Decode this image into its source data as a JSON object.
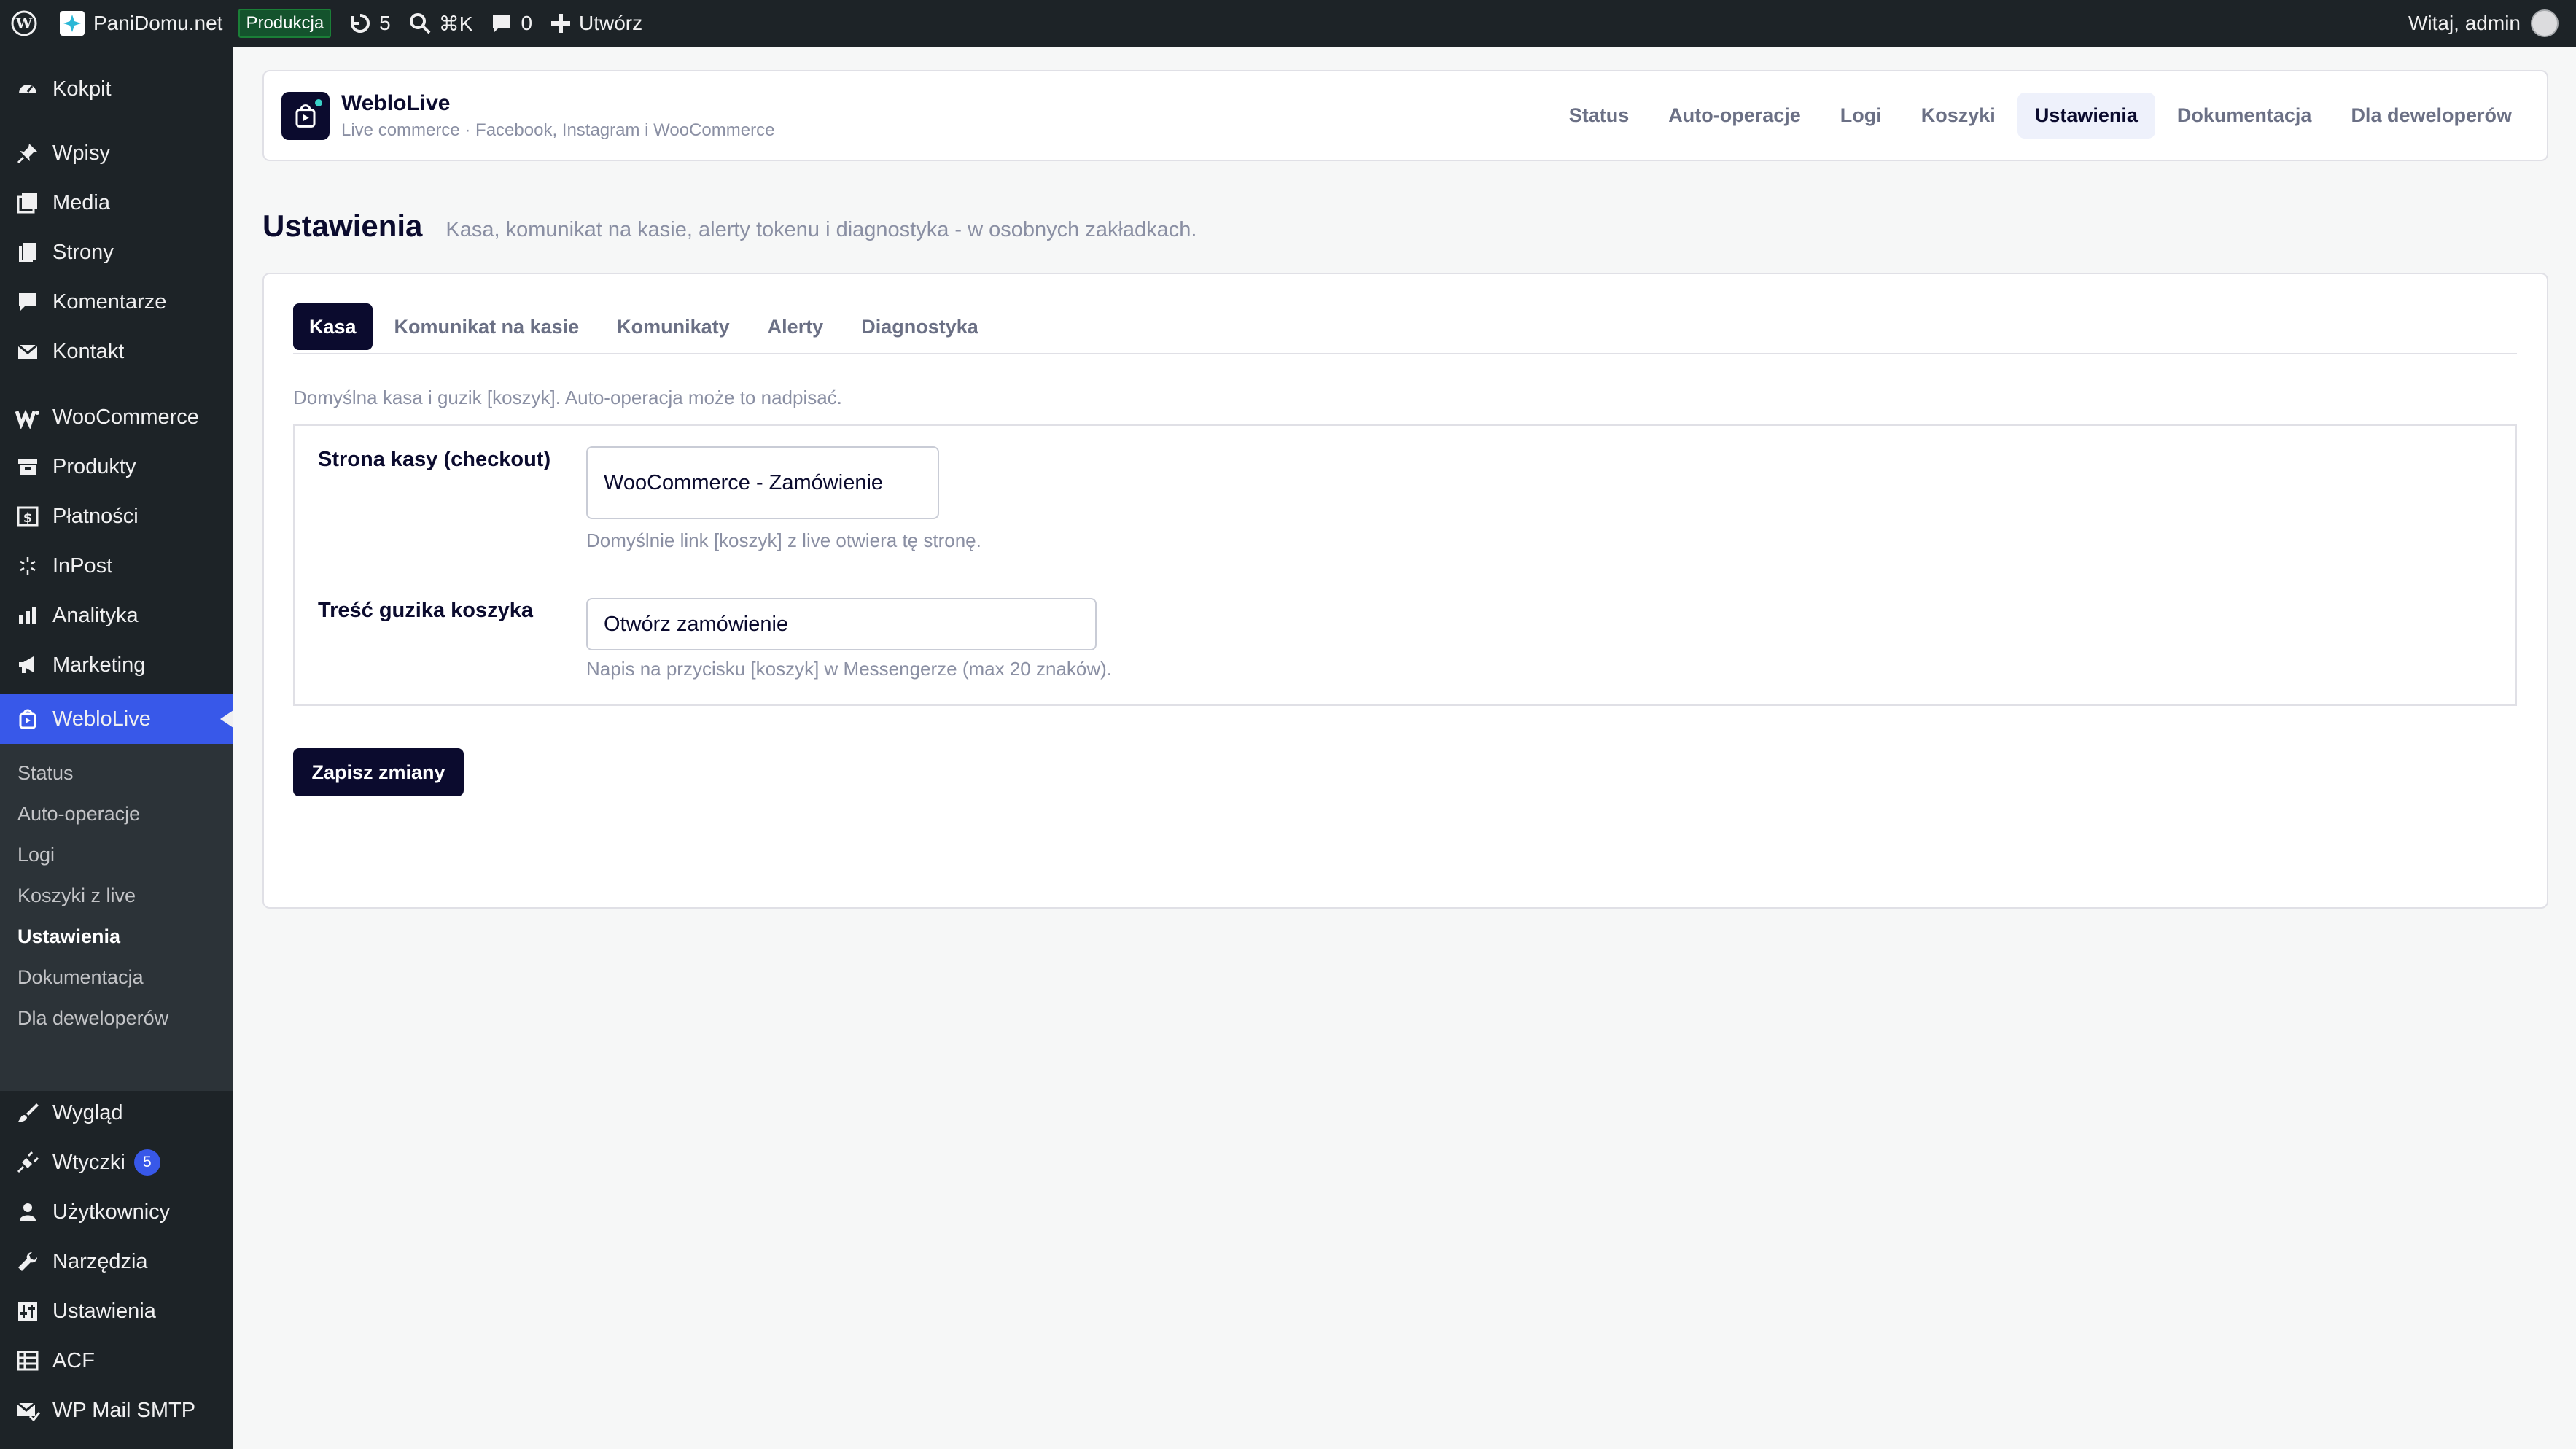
{
  "admin_bar": {
    "site_name": "PaniDomu.net",
    "env_badge": "Produkcja",
    "updates_count": "5",
    "search_shortcut": "⌘K",
    "comments_count": "0",
    "new_label": "Utwórz",
    "greeting": "Witaj, admin"
  },
  "sidebar": {
    "items": [
      {
        "label": "Kokpit",
        "icon": "dashboard-icon"
      },
      {
        "label": "Wpisy",
        "icon": "pin-icon"
      },
      {
        "label": "Media",
        "icon": "media-icon"
      },
      {
        "label": "Strony",
        "icon": "pages-icon"
      },
      {
        "label": "Komentarze",
        "icon": "comment-icon"
      },
      {
        "label": "Kontakt",
        "icon": "mail-icon"
      },
      {
        "label": "WooCommerce",
        "icon": "woocommerce-icon"
      },
      {
        "label": "Produkty",
        "icon": "archive-icon"
      },
      {
        "label": "Płatności",
        "icon": "payment-icon"
      },
      {
        "label": "InPost",
        "icon": "inpost-icon"
      },
      {
        "label": "Analityka",
        "icon": "chart-icon"
      },
      {
        "label": "Marketing",
        "icon": "megaphone-icon"
      },
      {
        "label": "WebloLive",
        "icon": "weblolive-icon"
      },
      {
        "label": "Wygląd",
        "icon": "brush-icon"
      },
      {
        "label": "Wtyczki",
        "icon": "plugin-icon",
        "badge": "5"
      },
      {
        "label": "Użytkownicy",
        "icon": "user-icon"
      },
      {
        "label": "Narzędzia",
        "icon": "wrench-icon"
      },
      {
        "label": "Ustawienia",
        "icon": "settings-icon"
      },
      {
        "label": "ACF",
        "icon": "table-icon"
      },
      {
        "label": "WP Mail SMTP",
        "icon": "mail-check-icon"
      }
    ],
    "submenu": [
      "Status",
      "Auto-operacje",
      "Logi",
      "Koszyki z live",
      "Ustawienia",
      "Dokumentacja",
      "Dla deweloperów"
    ]
  },
  "plugin_header": {
    "title": "WebloLive",
    "subtitle": "Live commerce · Facebook, Instagram i WooCommerce",
    "nav": [
      "Status",
      "Auto-operacje",
      "Logi",
      "Koszyki",
      "Ustawienia",
      "Dokumentacja",
      "Dla deweloperów"
    ],
    "active_nav": "Ustawienia"
  },
  "page": {
    "title": "Ustawienia",
    "description": "Kasa, komunikat na kasie, alerty tokenu i diagnostyka - w osobnych zakładkach."
  },
  "settings": {
    "tabs": [
      "Kasa",
      "Komunikat na kasie",
      "Komunikaty",
      "Alerty",
      "Diagnostyka"
    ],
    "active_tab": "Kasa",
    "note": "Domyślna kasa i guzik [koszyk]. Auto-operacja może to nadpisać.",
    "checkout_label": "Strona kasy (checkout)",
    "checkout_value": "WooCommerce - Zamówienie",
    "checkout_help": "Domyślnie link [koszyk] z live otwiera tę stronę.",
    "button_label": "Treść guzika koszyka",
    "button_value": "Otwórz zamówienie",
    "button_help": "Napis na przycisku [koszyk] w Messengerze (max 20 znaków).",
    "save_label": "Zapisz zmiany"
  },
  "colors": {
    "accent": "#3858e9",
    "dark": "#0b0b2e",
    "admin_bg": "#1d2327"
  }
}
